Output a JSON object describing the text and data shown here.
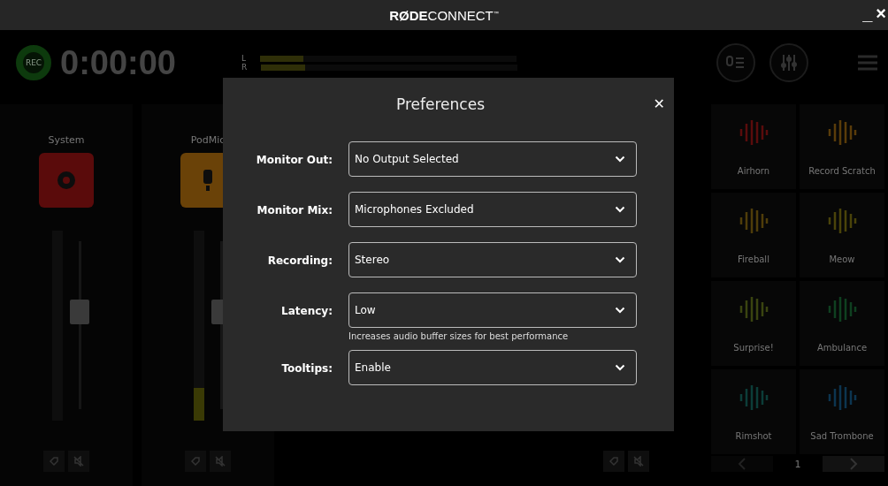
{
  "window": {
    "brand": "RØDE",
    "product": "CONNECT",
    "trademark": "™",
    "minimize": "_",
    "close": "×"
  },
  "header": {
    "record_label": "REC",
    "timer": "0:00:00",
    "meters": [
      {
        "label": "L",
        "level": 0.17
      },
      {
        "label": "R",
        "level": 0.17
      }
    ]
  },
  "channels": [
    {
      "name": "System",
      "kind": "system",
      "color": "#5a0b0b",
      "level": 0.58
    },
    {
      "name": "PodMic",
      "kind": "mic",
      "color": "#6a4208",
      "level": 0.58,
      "meter": {
        "level": 0.17
      }
    }
  ],
  "sound_pads": [
    {
      "name": "Airhorn",
      "color": "#5a0c0c"
    },
    {
      "name": "Record Scratch",
      "color": "#5a3c0a"
    },
    {
      "name": "Fireball",
      "color": "#4f3d0a"
    },
    {
      "name": "Meow",
      "color": "#4a430a"
    },
    {
      "name": "Surprise!",
      "color": "#3a4410"
    },
    {
      "name": "Ambulance",
      "color": "#0f4020"
    },
    {
      "name": "Rimshot",
      "color": "#0c3d38"
    },
    {
      "name": "Sad Trombone",
      "color": "#0c3550"
    }
  ],
  "pagination": {
    "page": "1"
  },
  "dialog": {
    "title": "Preferences",
    "close": "✕",
    "fields": [
      {
        "label": "Monitor Out:",
        "value": "No Output Selected"
      },
      {
        "label": "Monitor Mix:",
        "value": "Microphones Excluded"
      },
      {
        "label": "Recording:",
        "value": "Stereo"
      },
      {
        "label": "Latency:",
        "value": "Low",
        "hint": "Increases audio buffer sizes for best performance"
      },
      {
        "label": "Tooltips:",
        "value": "Enable"
      }
    ]
  }
}
